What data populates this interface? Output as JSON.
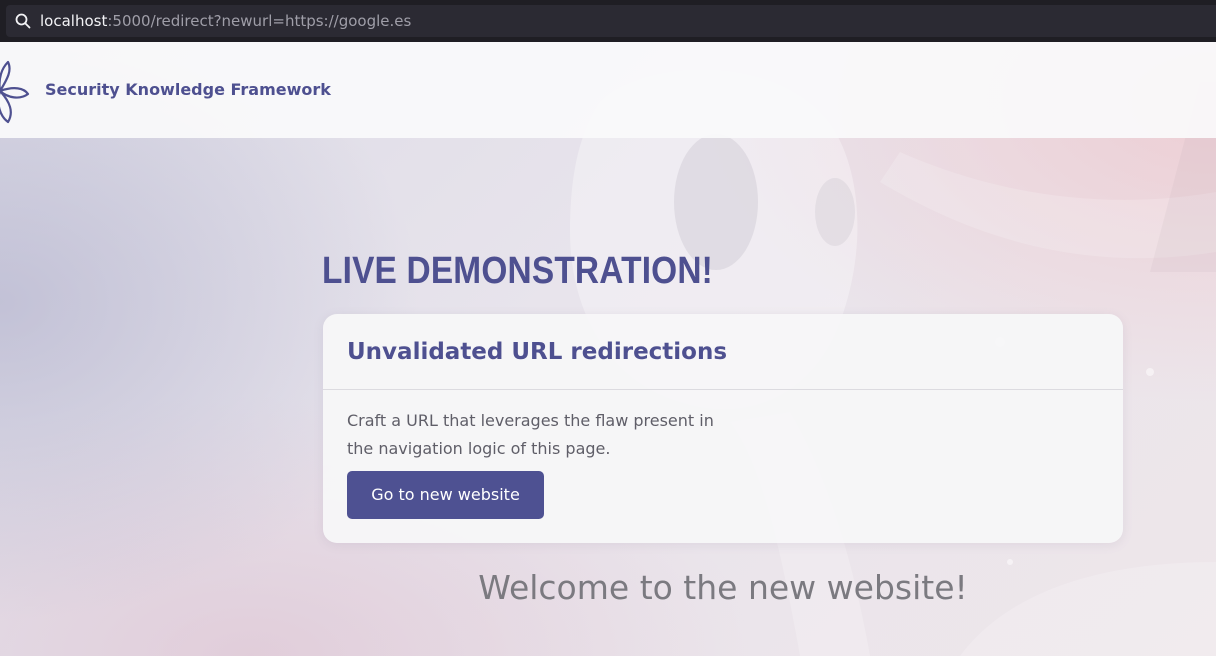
{
  "browser": {
    "url_host": "localhost",
    "url_rest": ":5000/redirect?newurl=https://google.es",
    "search_icon": "search-icon"
  },
  "header": {
    "logo_icon": "flower-logo-icon",
    "brand": "Security Knowledge Framework"
  },
  "main": {
    "title": "LIVE DEMONSTRATION!",
    "card": {
      "title": "Unvalidated URL redirections",
      "text_line1": "Craft a URL that leverages the flaw present in",
      "text_line2": "the navigation logic of this page.",
      "button_label": "Go to new website"
    },
    "welcome": "Welcome to the new website!"
  },
  "colors": {
    "accent": "#4e5090",
    "button": "#4e5192",
    "urlbar": "#1f1e24"
  }
}
